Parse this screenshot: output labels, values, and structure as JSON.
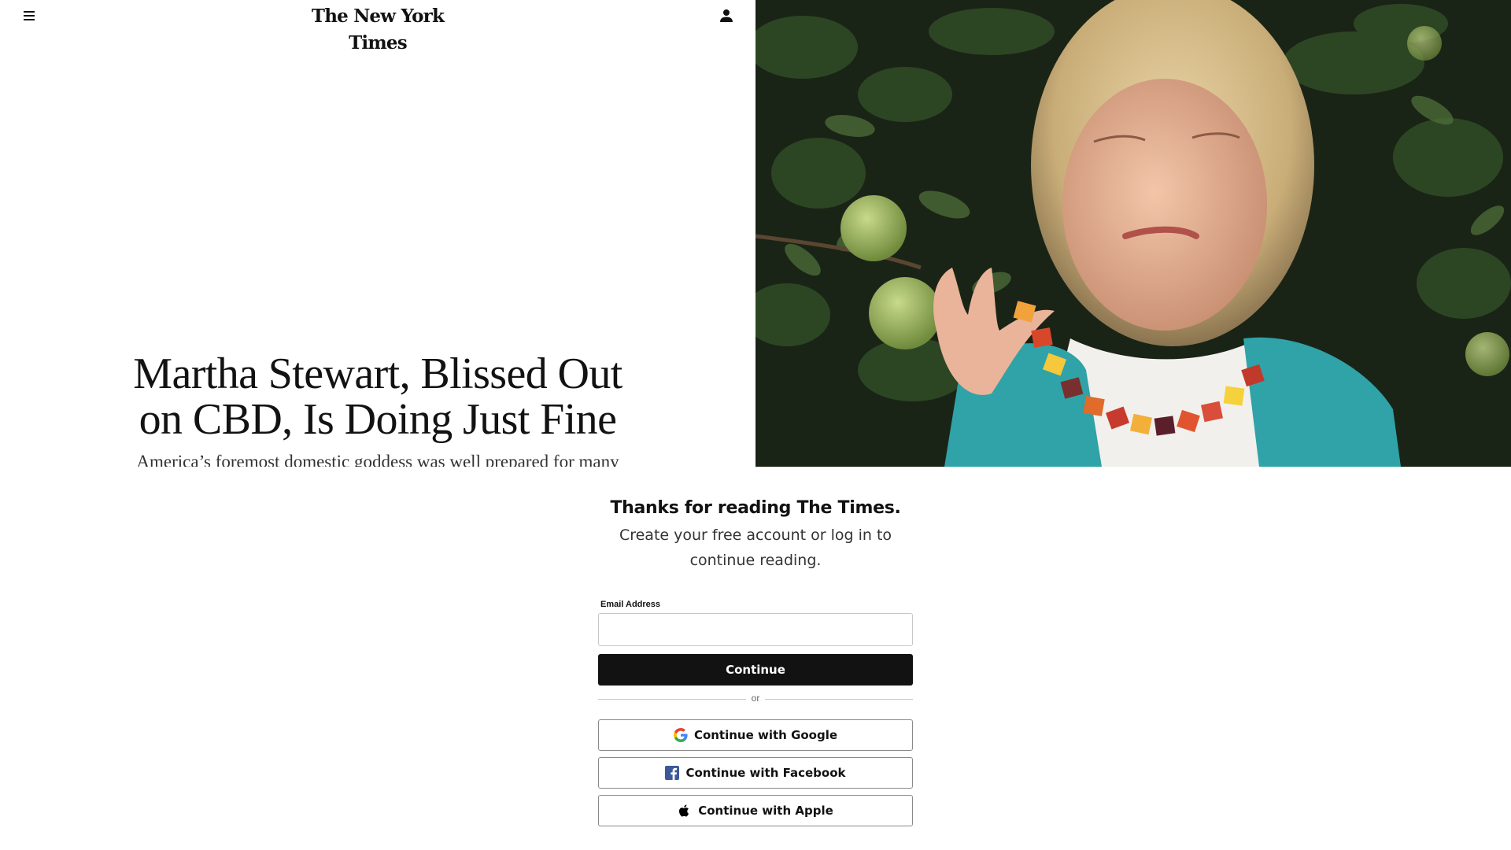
{
  "header": {
    "logo_text": "The New York Times",
    "menu_icon": "hamburger-menu-icon",
    "account_icon": "person-icon"
  },
  "article": {
    "headline": "Martha Stewart, Blissed Out on CBD, Is Doing Just Fine",
    "summary": "America’s foremost domestic goddess was well prepared for many",
    "image_subject": "Martha Stewart holding a gummy among green fruit trees"
  },
  "regiwall": {
    "title": "Thanks for reading The Times.",
    "subtitle": "Create your free account or log in to continue reading.",
    "email_label": "Email Address",
    "email_value": "",
    "continue_label": "Continue",
    "or_text": "or",
    "google_label": "Continue with Google",
    "facebook_label": "Continue with Facebook",
    "apple_label": "Continue with Apple"
  },
  "colors": {
    "text": "#121212",
    "button_dark": "#121212",
    "facebook_blue": "#1877F2",
    "google_blue": "#4285F4",
    "google_red": "#EA4335",
    "google_yellow": "#FBBC05",
    "google_green": "#34A853"
  }
}
